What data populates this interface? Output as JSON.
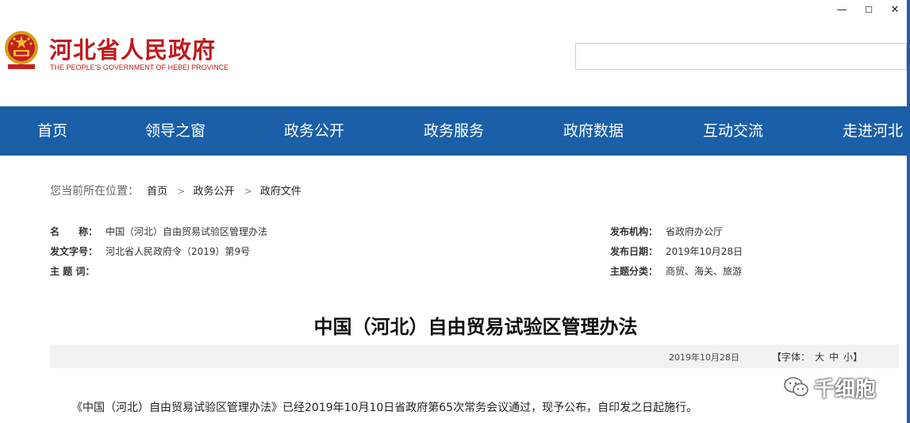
{
  "window": {
    "minimize": "—",
    "maximize": "☐",
    "close": "✕"
  },
  "header": {
    "title": "河北省人民政府",
    "subtitle": "THE PEOPLE'S GOVERNMENT OF HEBEI PROVINCE",
    "search": {
      "placeholder": "",
      "value": ""
    }
  },
  "nav": {
    "items": [
      "首页",
      "领导之窗",
      "政务公开",
      "政务服务",
      "政府数据",
      "互动交流",
      "走进河北"
    ]
  },
  "breadcrumb": {
    "label": "您当前所在位置：",
    "items": [
      "首页",
      "政务公开",
      "政府文件"
    ],
    "separator": ">"
  },
  "meta": {
    "name_label": "名　　称：",
    "name_value": "中国（河北）自由贸易试验区管理办法",
    "docno_label": "发文字号：",
    "docno_value": "河北省人民政府令（2019）第9号",
    "keywords_label": "主 题 词：",
    "keywords_value": "",
    "publisher_label": "发布机构：",
    "publisher_value": "省政府办公厅",
    "date_label": "发布日期：",
    "date_value": "2019年10月28日",
    "category_label": "主题分类：",
    "category_value": "商贸、海关、旅游"
  },
  "article": {
    "title": "中国（河北）自由贸易试验区管理办法",
    "date": "2019年10月28日",
    "font_label": "【字体：",
    "font_sizes": [
      "大",
      "中",
      "小"
    ],
    "font_close": "】",
    "first_paragraph": "《中国（河北）自由贸易试验区管理办法》已经2019年10月10日省政府第65次常务会议通过，现予公布，自印发之日起施行。"
  },
  "watermark": {
    "text": "千细胞"
  }
}
